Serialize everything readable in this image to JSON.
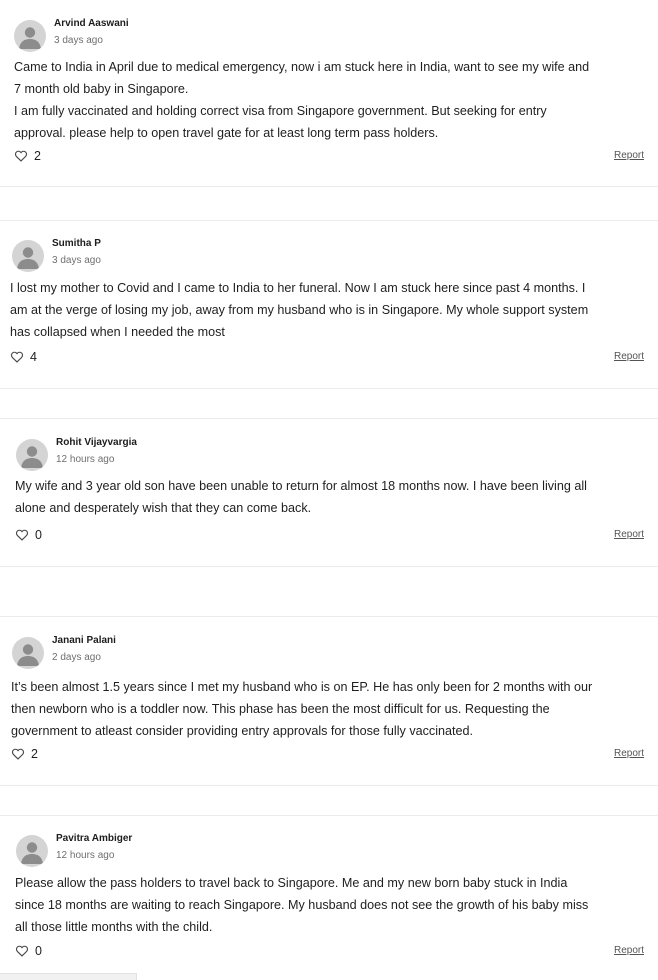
{
  "comments": [
    {
      "author": "Arvind Aaswani",
      "time": "3 days ago",
      "lines": [
        "Came to India in April due to medical emergency, now i am stuck here in India, want to see my wife and",
        "7 month old baby in Singapore.",
        "I am fully vaccinated and holding correct visa from Singapore government. But seeking for entry",
        "approval. please help to open travel gate for at least long term pass holders."
      ],
      "likes": "2",
      "report_label": "Report"
    },
    {
      "author": "Sumitha P",
      "time": "3 days ago",
      "lines": [
        "I lost my mother to Covid and I came to India to her funeral. Now I am stuck here since past 4 months. I",
        "am at the verge of losing my job, away from my husband who is in Singapore. My whole support system",
        "has collapsed when I needed the most"
      ],
      "likes": "4",
      "report_label": "Report"
    },
    {
      "author": "Rohit Vijayvargia",
      "time": "12 hours ago",
      "lines": [
        "My wife and 3 year old son have been unable to return for almost 18 months now. I have been living all",
        "alone and desperately wish that they can come back."
      ],
      "likes": "0",
      "report_label": "Report"
    },
    {
      "author": "Janani Palani",
      "time": "2 days ago",
      "lines": [
        "It’s been almost 1.5 years since I met my husband who is on EP. He has only been for 2 months with our",
        "then newborn who is a toddler now. This phase has been the most difficult for us. Requesting the",
        "government to atleast consider providing entry approvals for those fully vaccinated."
      ],
      "likes": "2",
      "report_label": "Report"
    },
    {
      "author": "Pavitra Ambiger",
      "time": "12 hours ago",
      "lines": [
        "Please allow the pass holders to travel back to Singapore. Me and my new born baby stuck in India",
        "since 18 months are waiting to reach Singapore. My husband does not see the growth of his baby miss",
        "all those little months with the child."
      ],
      "likes": "0",
      "report_label": "Report"
    }
  ],
  "icons": {
    "avatar": "user-silhouette-icon",
    "like": "heart-outline-icon"
  },
  "colors": {
    "text": "#1f1f1f",
    "muted": "#6f6f6f",
    "divider": "#ececec",
    "avatar_bg": "#d4d4d4"
  }
}
